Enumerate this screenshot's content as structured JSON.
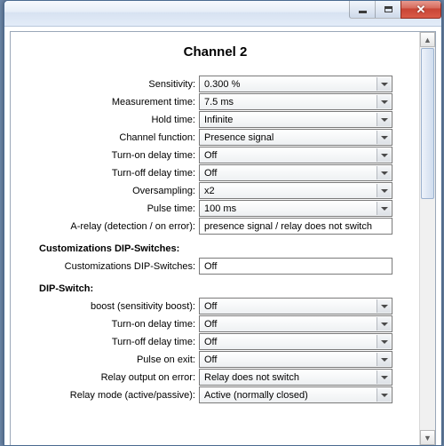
{
  "title": "Channel 2",
  "sections": {
    "custom": "Customizations DIP-Switches:",
    "dip": "DIP-Switch:"
  },
  "rows": {
    "sensitivity": {
      "label": "Sensitivity:",
      "value": "0.300 %"
    },
    "meas_time": {
      "label": "Measurement time:",
      "value": "7.5 ms"
    },
    "hold_time": {
      "label": "Hold time:",
      "value": "Infinite"
    },
    "chan_func": {
      "label": "Channel function:",
      "value": "Presence signal"
    },
    "turnon_delay": {
      "label": "Turn-on delay time:",
      "value": "Off"
    },
    "turnoff_delay": {
      "label": "Turn-off delay time:",
      "value": "Off"
    },
    "oversampling": {
      "label": "Oversampling:",
      "value": "x2"
    },
    "pulse_time": {
      "label": "Pulse time:",
      "value": "100 ms"
    },
    "arelay": {
      "label": "A-relay (detection / on error):",
      "value": "presence signal / relay does not switch"
    },
    "custom_dip": {
      "label": "Customizations DIP-Switches:",
      "value": "Off"
    },
    "boost": {
      "label": "boost (sensitivity boost):",
      "value": "Off"
    },
    "dip_turnon": {
      "label": "Turn-on delay time:",
      "value": "Off"
    },
    "dip_turnoff": {
      "label": "Turn-off delay time:",
      "value": "Off"
    },
    "pulse_exit": {
      "label": "Pulse on exit:",
      "value": "Off"
    },
    "relay_err": {
      "label": "Relay output on error:",
      "value": "Relay does not switch"
    },
    "relay_mode": {
      "label": "Relay mode (active/passive):",
      "value": "Active (normally closed)"
    }
  }
}
